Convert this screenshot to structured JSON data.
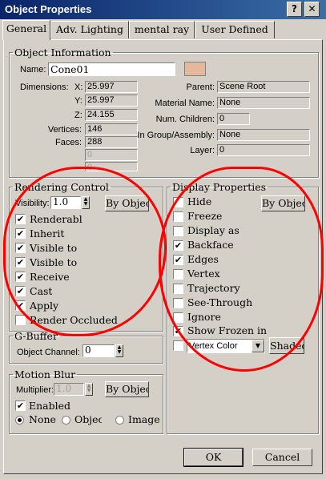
{
  "window": {
    "title": "Object Properties",
    "help_glyph": "?",
    "close_glyph": "✕"
  },
  "tabs": [
    "General",
    "Adv. Lighting",
    "mental ray",
    "User Defined"
  ],
  "object_info": {
    "legend": "Object Information",
    "name_label": "Name:",
    "name_value": "Cone01",
    "color_swatch": "#e6b89b",
    "dimensions_label": "Dimensions:",
    "x_label": "X:",
    "x_value": "25.997",
    "y_label": "Y:",
    "y_value": "25.997",
    "z_label": "Z:",
    "z_value": "24.155",
    "vertices_label": "Vertices:",
    "vertices_value": "146",
    "faces_label": "Faces:",
    "faces_value": "288",
    "extra1": "0",
    "extra2": "0",
    "parent_label": "Parent:",
    "parent_value": "Scene Root",
    "material_label": "Material Name:",
    "material_value": "None",
    "children_label": "Num. Children:",
    "children_value": "0",
    "group_label": "In Group/Assembly:",
    "group_value": "None",
    "layer_label": "Layer:",
    "layer_value": "0"
  },
  "rendering": {
    "legend": "Rendering Control",
    "visibility_label": "Visibility:",
    "visibility_value": "1.0",
    "by_object": "By Object",
    "items": [
      {
        "label": "Renderabl",
        "checked": true
      },
      {
        "label": "Inherit",
        "checked": true
      },
      {
        "label": "Visible to",
        "checked": true
      },
      {
        "label": "Visible to",
        "checked": true
      },
      {
        "label": "Receive",
        "checked": true
      },
      {
        "label": "Cast",
        "checked": true
      },
      {
        "label": "Apply",
        "checked": true
      },
      {
        "label": "Render Occluded",
        "checked": false
      }
    ]
  },
  "display": {
    "legend": "Display Properties",
    "by_object": "By Object",
    "items": [
      {
        "label": "Hide",
        "checked": false
      },
      {
        "label": "Freeze",
        "checked": false
      },
      {
        "label": "Display as",
        "checked": false
      },
      {
        "label": "Backface",
        "checked": true
      },
      {
        "label": "Edges",
        "checked": true
      },
      {
        "label": "Vertex",
        "checked": false
      },
      {
        "label": "Trajectory",
        "checked": false
      },
      {
        "label": "See-Through",
        "checked": false
      },
      {
        "label": "Ignore",
        "checked": false
      },
      {
        "label": "Show Frozen in",
        "checked": true
      }
    ],
    "vertex_color": "Vertex Color",
    "shaded": "Shaded"
  },
  "gbuffer": {
    "legend": "G-Buffer",
    "channel_label": "Object Channel:",
    "channel_value": "0"
  },
  "motion_blur": {
    "legend": "Motion Blur",
    "multiplier_label": "Multiplier:",
    "multiplier_value": "1.0",
    "by_object": "By Object",
    "enabled_label": "Enabled",
    "options": [
      "None",
      "Object",
      "Image"
    ]
  },
  "buttons": {
    "ok": "OK",
    "cancel": "Cancel"
  },
  "annotation_color": "#ff0000"
}
